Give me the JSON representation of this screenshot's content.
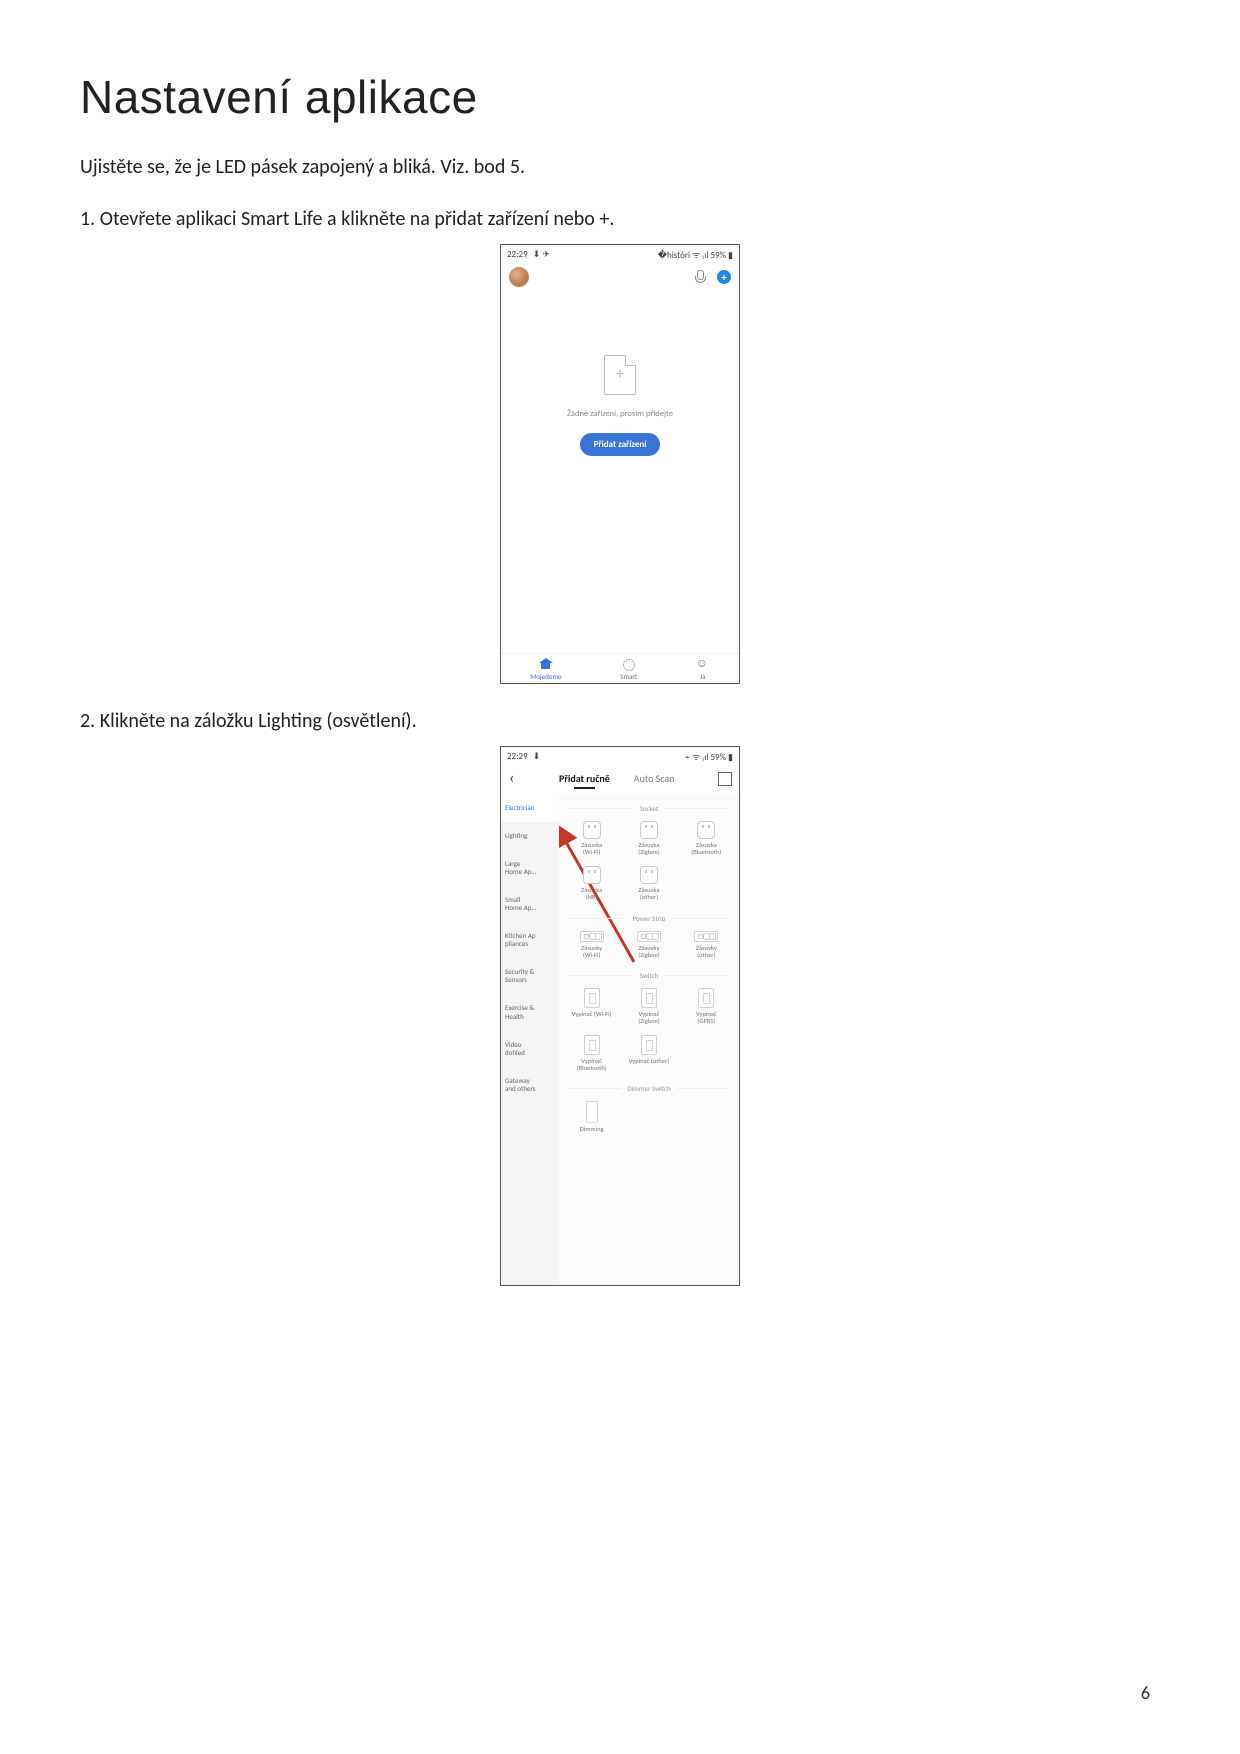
{
  "page": {
    "title": "Nastavení aplikace",
    "intro": "Ujistěte se, že je LED pásek zapojený a bliká. Viz. bod 5.",
    "step1": "1.  Otevřete aplikaci Smart Life a klikněte na přidat zařízení nebo +.",
    "step2": "2.  Klikněte na záložku Lighting (osvětlení).",
    "number": "6"
  },
  "phone1": {
    "status_time": "22:29 ",
    "status_left_extras": "⬇ ✈",
    "status_right": "�históri ᯤ ₎ıl 59% ▮",
    "plus": "+",
    "empty_text": "Žádné zařízení, prosím přidejte",
    "add_btn": "Přidat zařízení",
    "nav_home": "Mojedomo",
    "nav_smart": "Smart",
    "nav_me": "Já"
  },
  "phone2": {
    "status_time": "22:29 ",
    "status_left_extras": "⬇",
    "status_right": "⌁ ᯤ ₎ıl 59% ▮",
    "tab_manual": "Přidat ručně",
    "tab_auto": "Auto Scan",
    "categories": [
      "Electrician",
      "Lighting",
      "Large\nHome Ap…",
      "Small\nHome Ap…",
      "Kitchen Ap\npliances",
      "Security &\nSensors",
      "Exercise &\nHealth",
      "Video\ndohled",
      "Gateway\nand others"
    ],
    "section_socket": "Socket",
    "devices_socket": [
      {
        "name": "Zásuvka",
        "sub": "(Wi-Fi)",
        "icon": "sock"
      },
      {
        "name": "Zásuvka",
        "sub": "(Zigbee)",
        "icon": "sock"
      },
      {
        "name": "Zásuvka",
        "sub": "(Bluetooth)",
        "icon": "sock"
      },
      {
        "name": "Zásuvka",
        "sub": "(NB)",
        "icon": "sock"
      },
      {
        "name": "Zásuvka",
        "sub": "(other)",
        "icon": "sock"
      }
    ],
    "section_strip": "Power Strip",
    "devices_strip": [
      {
        "name": "Zásuvky",
        "sub": "(Wi-Fi)",
        "icon": "strip"
      },
      {
        "name": "Zásuvky",
        "sub": "(Zigbee)",
        "icon": "strip"
      },
      {
        "name": "Zásuvky",
        "sub": "(other)",
        "icon": "strip"
      }
    ],
    "section_switch": "Switch",
    "devices_switch": [
      {
        "name": "Vypínač (Wi-Fi)",
        "sub": "",
        "icon": "swbox"
      },
      {
        "name": "Vypínač",
        "sub": "(Zigbee)",
        "icon": "swbox"
      },
      {
        "name": "Vypínač",
        "sub": "(GPRS)",
        "icon": "swbox"
      },
      {
        "name": "Vypínač",
        "sub": "(Bluetooth)",
        "icon": "swbox"
      },
      {
        "name": "Vypínač (other)",
        "sub": "",
        "icon": "swbox"
      }
    ],
    "section_dimmer": "Dimmer Switch",
    "devices_dimmer": [
      {
        "name": "Dimming",
        "sub": "",
        "icon": "dim"
      }
    ]
  }
}
